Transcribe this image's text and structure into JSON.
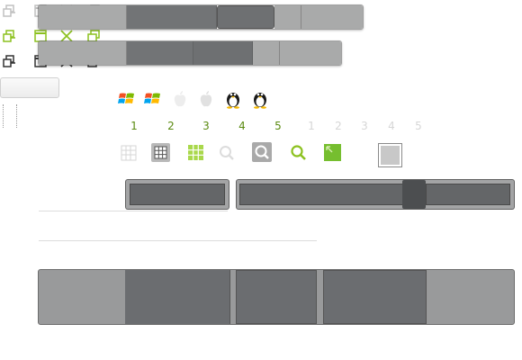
{
  "colors": {
    "green": "#8cc11f",
    "dark": "#3a3a3a",
    "bar_light": "#a9aaaa",
    "bar_dark": "#6f7173",
    "panel_light": "#999a9b",
    "panel_dark": "#6b6d70"
  },
  "icons": {
    "window_controls": [
      "restore-icon",
      "maximize-icon",
      "close-icon",
      "minimize-to-tray-icon"
    ],
    "os": [
      "windows-icon",
      "windows-icon",
      "apple-icon",
      "apple-icon",
      "linux-tux-icon",
      "linux-tux-icon"
    ],
    "toolbar": [
      "grid-icon",
      "grid-icon",
      "grid-icon",
      "search-icon",
      "search-icon",
      "search-icon",
      "resize-icon"
    ]
  },
  "pager": {
    "active_numbers": [
      "1",
      "2",
      "3",
      "4",
      "5"
    ],
    "inactive_numbers": [
      "1",
      "2",
      "3",
      "4",
      "5"
    ]
  }
}
